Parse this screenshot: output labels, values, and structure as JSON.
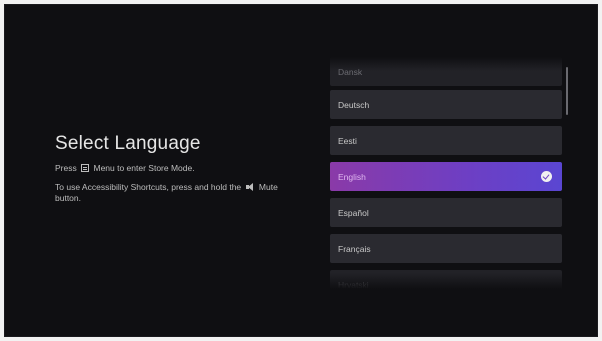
{
  "page": {
    "title": "Select Language",
    "instruction_store_prefix": "Press",
    "instruction_store_suffix": "Menu to enter Store Mode.",
    "instruction_access_prefix": "To use Accessibility Shortcuts, press and hold the",
    "instruction_access_suffix": "Mute button."
  },
  "icons": {
    "menu": "menu-icon",
    "mute": "mute-icon",
    "selected": "check-circle-icon"
  },
  "languages": {
    "items": [
      {
        "label": "Dansk"
      },
      {
        "label": "Deutsch"
      },
      {
        "label": "Eesti"
      },
      {
        "label": "English",
        "selected": true
      },
      {
        "label": "Español"
      },
      {
        "label": "Français"
      },
      {
        "label": "Hrvatski"
      }
    ]
  },
  "colors": {
    "background": "#0f0f12",
    "item": "#2a2a30",
    "selected_start": "#8a3aa8",
    "selected_end": "#5a46d2"
  }
}
